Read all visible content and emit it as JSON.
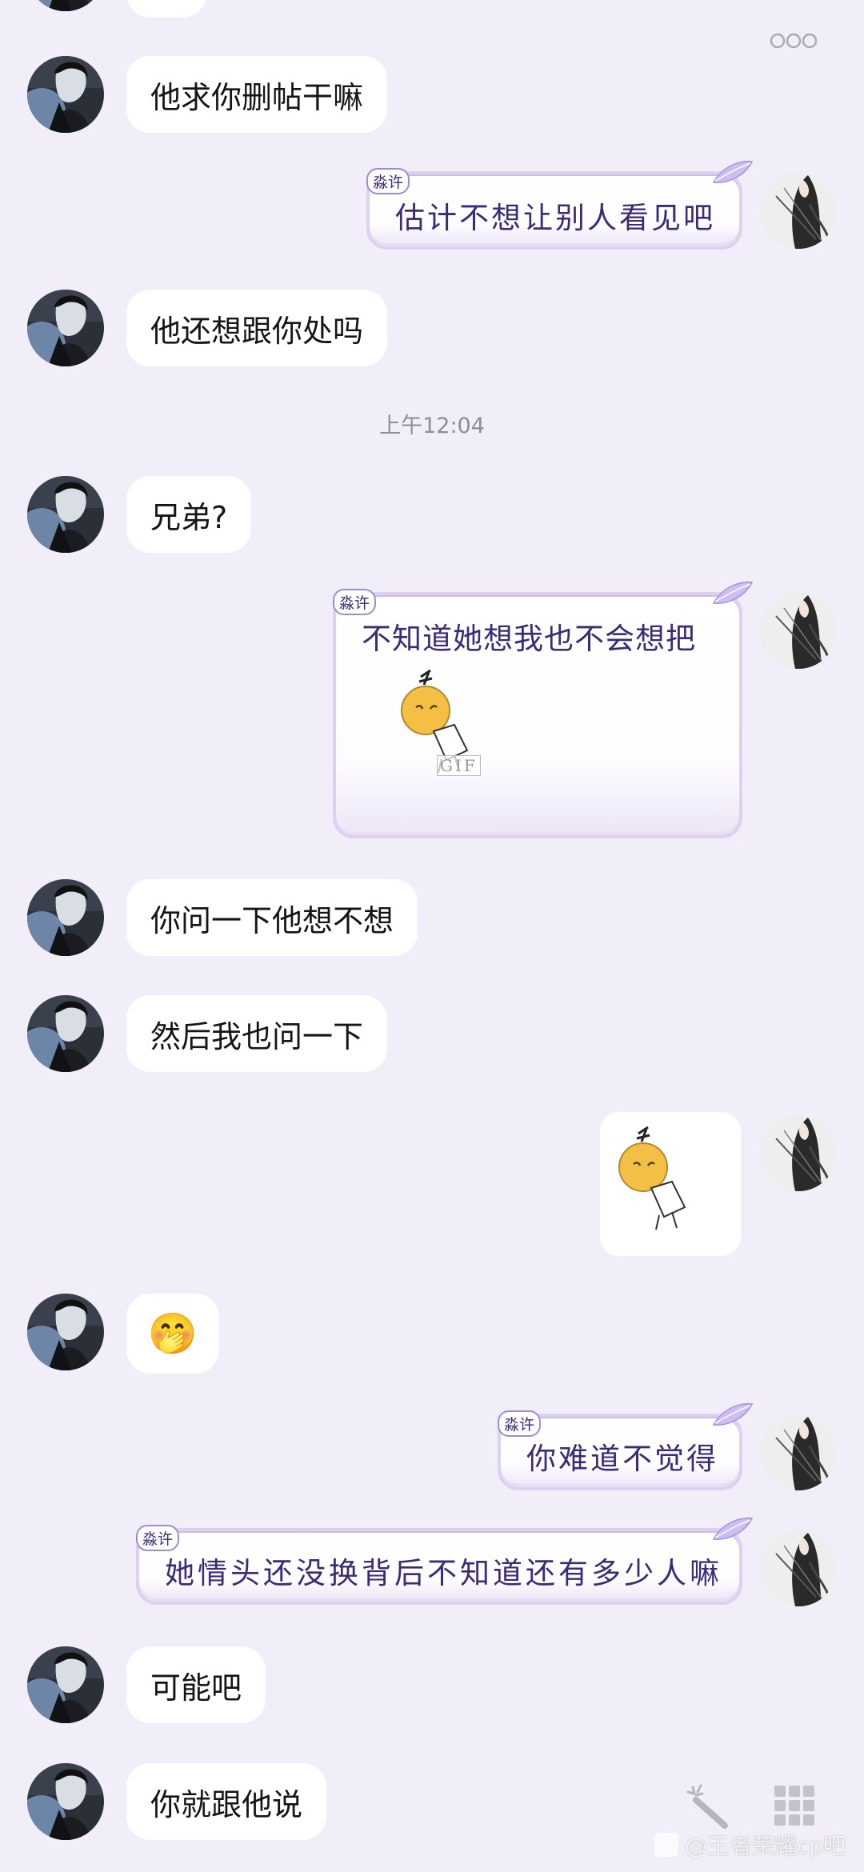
{
  "chat": {
    "more_icon": "more-icon",
    "timestamp": "上午12:04",
    "messages": [
      {
        "side": "left",
        "text": "他求你删帖干嘛"
      },
      {
        "side": "right",
        "tag": "淼许",
        "text": "估计不想让别人看见吧"
      },
      {
        "side": "left",
        "text": "他还想跟你处吗"
      },
      {
        "side": "left",
        "text": "兄弟?"
      },
      {
        "side": "right",
        "tag": "淼许",
        "text": "不知道她想我也不会想把",
        "sticker": "orange-head-sticker",
        "sticker_badge": "GIF"
      },
      {
        "side": "left",
        "text": "你问一下他想不想"
      },
      {
        "side": "left",
        "text": "然后我也问一下"
      },
      {
        "side": "right",
        "sticker": "orange-head-sticker"
      },
      {
        "side": "left",
        "emoji": "🤭"
      },
      {
        "side": "right",
        "tag": "淼许",
        "text": "你难道不觉得"
      },
      {
        "side": "right",
        "tag": "淼许",
        "text": "她情头还没换背后不知道还有多少人嘛"
      },
      {
        "side": "left",
        "text": "可能吧"
      },
      {
        "side": "left",
        "text": "你就跟他说"
      }
    ]
  },
  "footer": {
    "watermark": "@王者荣耀cp吧",
    "magic_wand_icon": "magic-wand-icon",
    "grid_icon": "grid-icon"
  },
  "colors": {
    "background": "#f1eef9",
    "bubble_left": "#ffffff",
    "bubble_right_text": "#3b2a74",
    "bubble_right_border": "#dcd2f0"
  }
}
